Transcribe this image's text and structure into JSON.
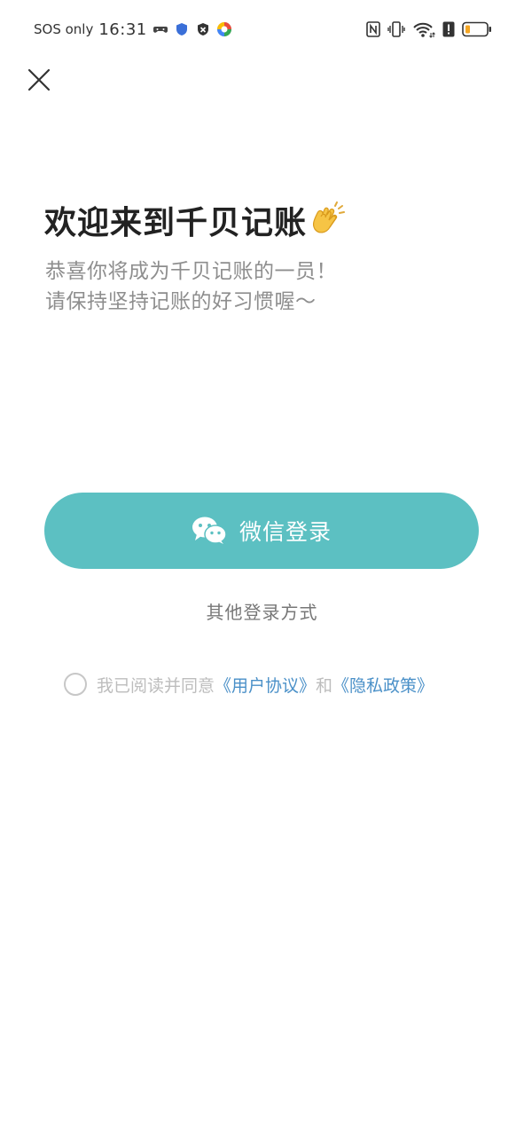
{
  "status_bar": {
    "carrier": "SOS only",
    "time": "16:31",
    "battery_color": "#f5a623"
  },
  "header": {
    "close_icon": "close-icon"
  },
  "welcome": {
    "title": "欢迎来到千贝记账",
    "title_emoji": "clapping-hands-icon",
    "subtitle_line1": "恭喜你将成为千贝记账的一员！",
    "subtitle_line2": "请保持坚持记账的好习惯喔～"
  },
  "login": {
    "wechat_label": "微信登录",
    "wechat_icon": "wechat-icon",
    "button_color": "#5cc0c2",
    "other_methods": "其他登录方式"
  },
  "agreement": {
    "checked": false,
    "prefix": "我已阅读并同意",
    "user_agreement": "《用户协议》",
    "conjunction": "和",
    "privacy_policy": "《隐私政策》",
    "link_color": "#4a90c8"
  }
}
